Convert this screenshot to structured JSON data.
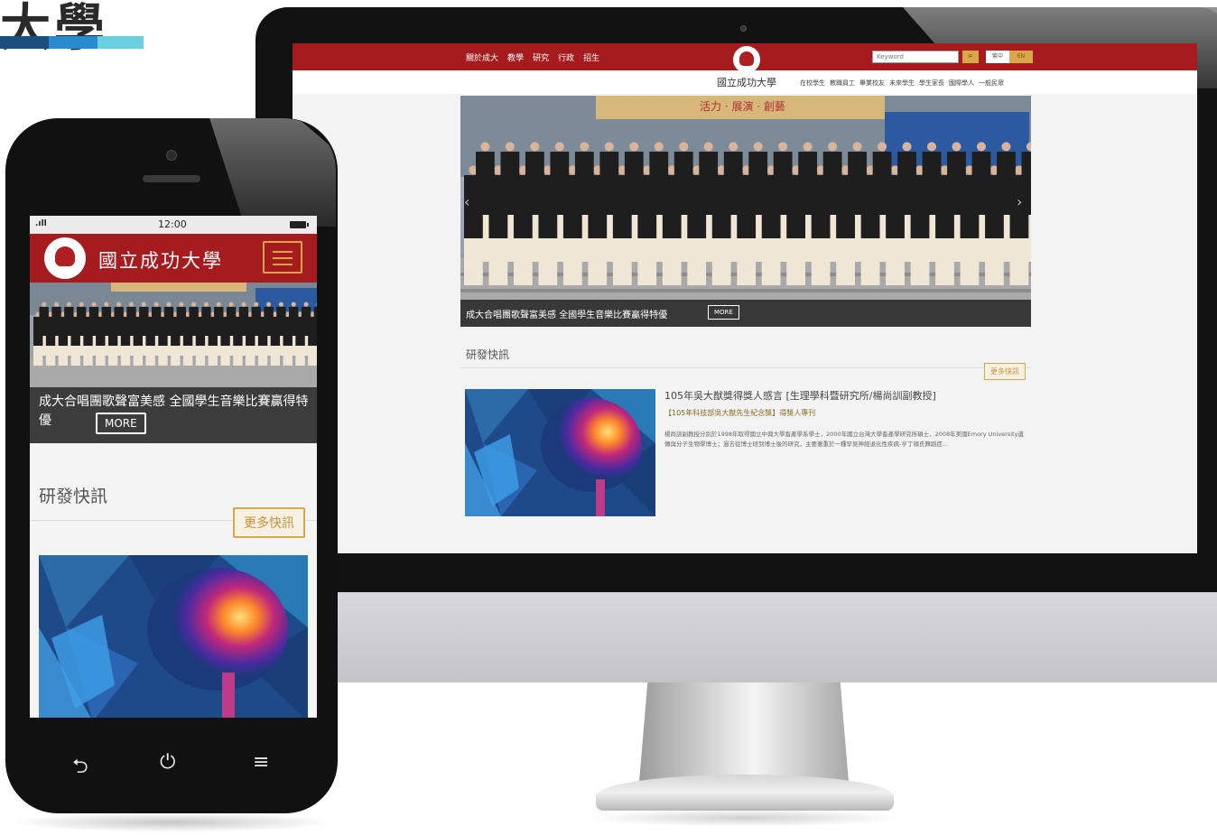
{
  "page": {
    "title_fragment": "大學",
    "bar_colors": [
      "#1a4f80",
      "#2a8ad0",
      "#6ad0e0"
    ]
  },
  "colors": {
    "brand_red": "#a61b1d",
    "gold": "#d9a64a"
  },
  "desktop": {
    "nav": [
      "關於成大",
      "教學",
      "研究",
      "行政",
      "招生"
    ],
    "logo_icon": "ncku-emblem",
    "wordmark": "國立成功大學",
    "search": {
      "placeholder": "Keyword",
      "icon": "search-icon"
    },
    "lang": {
      "zh": "繁中",
      "en": "EN"
    },
    "audience_nav": [
      "在校學生",
      "教職員工",
      "畢業校友",
      "未來學生",
      "學生家長",
      "國際學人",
      "一般民眾"
    ],
    "hero": {
      "banner_text": "活力 · 展演 · 創藝",
      "caption": "成大合唱團歌聲富美感 全國學生音樂比賽贏得特優",
      "more_label": "MORE"
    },
    "section_title": "研發快訊",
    "more_news_label": "更多快訊",
    "news": {
      "title": "105年吳大猷獎得獎人感言 [生理學科暨研究所/楊尚訓副教授]",
      "subtitle": "【105年科技部吳大猷先生紀念獎】得獎人專刊",
      "body": "楊尚訓副教授分別於1998年取得國立中興大學畜產學系學士，2000年國立台灣大學畜產學研究所碩士，2008年美國Emory University遺傳與分子生物學博士；過去從博士班到博士後的研究，主要著重於一種罕見神經退化性疾病-亨丁頓氏舞蹈症..."
    }
  },
  "phone": {
    "status": {
      "signal": ".ıll",
      "time": "12:00"
    },
    "logo_icon": "ncku-emblem",
    "wordmark": "國立成功大學",
    "menu_icon": "hamburger-menu-icon",
    "hero": {
      "caption": "成大合唱團歌聲富美感 全國學生音樂比賽贏得特優",
      "more_label": "MORE"
    },
    "section_title": "研發快訊",
    "more_news_label": "更多快訊",
    "nav_buttons": {
      "back": "⮌",
      "power": "⏻",
      "menu": "≡"
    }
  }
}
